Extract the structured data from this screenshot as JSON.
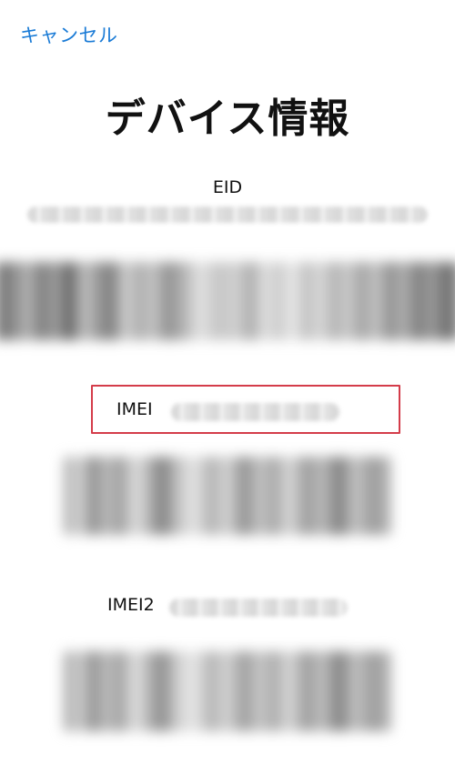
{
  "header": {
    "cancel_label": "キャンセル"
  },
  "page": {
    "title": "デバイス情報"
  },
  "eid": {
    "label": "EID"
  },
  "imei": {
    "label": "IMEI"
  },
  "imei2": {
    "label": "IMEI2"
  },
  "colors": {
    "accent": "#1a7bd6",
    "highlight_border": "#d43c4a",
    "text": "#111111",
    "background": "#ffffff"
  }
}
